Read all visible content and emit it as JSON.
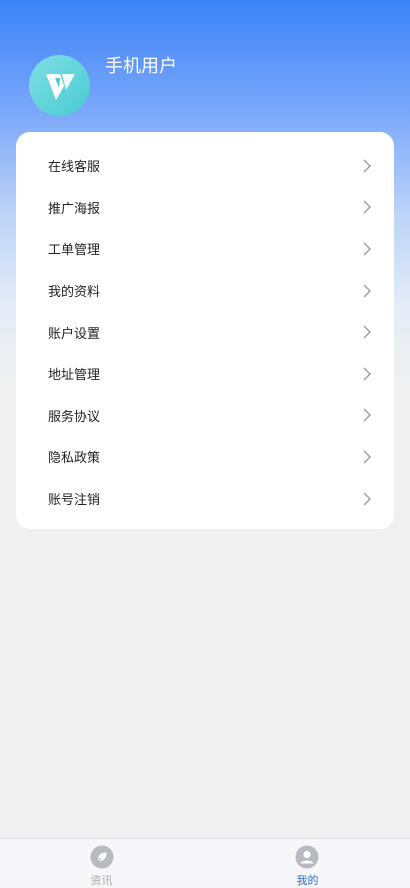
{
  "profile": {
    "username": "手机用户",
    "avatar_icon": "app-logo-icon"
  },
  "menu": [
    {
      "label": "在线客服",
      "icon": "chevron-right-icon"
    },
    {
      "label": "推广海报",
      "icon": "chevron-right-icon"
    },
    {
      "label": "工单管理",
      "icon": "chevron-right-icon"
    },
    {
      "label": "我的资料",
      "icon": "chevron-right-icon"
    },
    {
      "label": "账户设置",
      "icon": "chevron-right-icon"
    },
    {
      "label": "地址管理",
      "icon": "chevron-right-icon"
    },
    {
      "label": "服务协议",
      "icon": "chevron-right-icon"
    },
    {
      "label": "隐私政策",
      "icon": "chevron-right-icon"
    },
    {
      "label": "账号注销",
      "icon": "chevron-right-icon"
    }
  ],
  "tabbar": {
    "tabs": [
      {
        "label": "资讯",
        "icon": "news-icon",
        "active": false
      },
      {
        "label": "我的",
        "icon": "user-icon",
        "active": true
      }
    ]
  },
  "colors": {
    "header_top": "#3b82f8",
    "active_tab": "#2f6ad9",
    "inactive_tab": "#a9a9b2",
    "avatar": "#49c9d3"
  }
}
